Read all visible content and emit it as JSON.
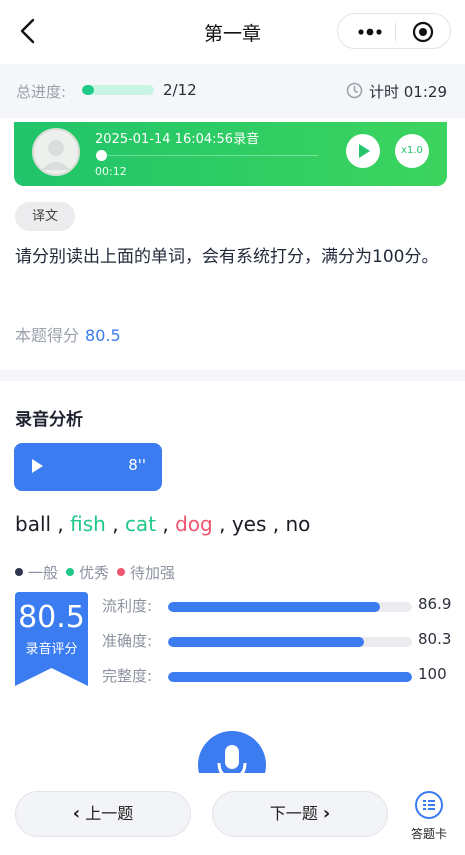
{
  "nav": {
    "title": "第一章"
  },
  "progress": {
    "label": "总进度:",
    "count": "2/12",
    "fraction": 0.167,
    "timer": "计时 01:29"
  },
  "recording": {
    "title": "2025-01-14 16:04:56录音",
    "duration": "00:12",
    "speed": "x1.0"
  },
  "question": {
    "tag": "译文",
    "text": "请分别读出上面的单词，会有系统打分，满分为100分。",
    "score_label": "本题得分",
    "score_value": "80.5"
  },
  "analysis": {
    "title": "录音分析",
    "audio_seconds": "8''",
    "words": [
      {
        "text": "ball",
        "level": "一般"
      },
      {
        "text": "fish",
        "level": "优秀"
      },
      {
        "text": "cat",
        "level": "优秀"
      },
      {
        "text": "dog",
        "level": "待加强"
      },
      {
        "text": "yes",
        "level": "一般"
      },
      {
        "text": "no",
        "level": "一般"
      }
    ],
    "legend": [
      {
        "label": "一般",
        "color": "#2e3650"
      },
      {
        "label": "优秀",
        "color": "#20c98a"
      },
      {
        "label": "待加强",
        "color": "#f0566f"
      }
    ],
    "overall_score": "80.5",
    "overall_label": "录音评分",
    "metrics": [
      {
        "label": "流利度:",
        "value": "86.9",
        "fraction": 0.869
      },
      {
        "label": "准确度:",
        "value": "80.3",
        "fraction": 0.803
      },
      {
        "label": "完整度:",
        "value": "100",
        "fraction": 1.0
      }
    ]
  },
  "footer": {
    "prev_label": "上一题",
    "next_label": "下一题",
    "card_label": "答题卡"
  },
  "colors": {
    "accent": "#3b7cf0",
    "player_green": "#24c668",
    "progress_green": "#1fcb88"
  }
}
